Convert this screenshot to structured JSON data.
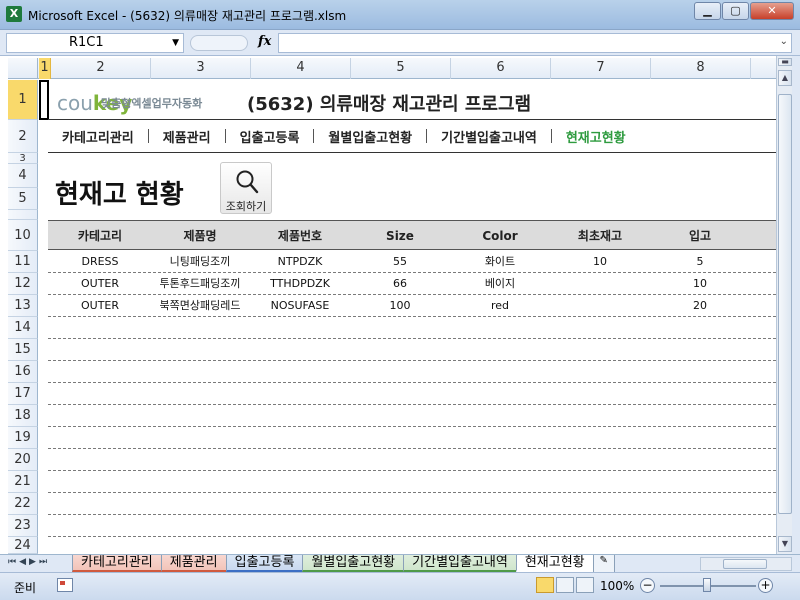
{
  "window": {
    "app_icon": "X",
    "title": "Microsoft Excel - (5632) 의류매장 재고관리 프로그램.xlsm",
    "minimize": "▁",
    "maximize": "▢",
    "close": "✕"
  },
  "formula_bar": {
    "name_box": "R1C1",
    "fx": "fx",
    "formula": ""
  },
  "columns": [
    "1",
    "2",
    "3",
    "4",
    "5",
    "6",
    "7",
    "8"
  ],
  "rows": [
    "1",
    "2",
    "3",
    "4",
    "5",
    "10",
    "11",
    "12",
    "13",
    "14",
    "15",
    "16",
    "17",
    "18",
    "19",
    "20",
    "21",
    "22",
    "23",
    "24"
  ],
  "sheet": {
    "brand": {
      "cou": "cou",
      "key": "key",
      "sub": "맞춤형엑셀업무자동화"
    },
    "app_title": "(5632) 의류매장 재고관리 프로그램",
    "menu": [
      "카테고리관리",
      "제품관리",
      "입출고등록",
      "월별입출고현황",
      "기간별입출고내역",
      "현재고현황"
    ],
    "active_menu": "현재고현황",
    "page_title": "현재고 현황",
    "search_button": "조회하기",
    "table": {
      "headers": [
        "카테고리",
        "제품명",
        "제품번호",
        "Size",
        "Color",
        "최초재고",
        "입고"
      ],
      "rows": [
        [
          "DRESS",
          "니팅패딩조끼",
          "NTPDZK",
          "55",
          "화이트",
          "10",
          "5"
        ],
        [
          "OUTER",
          "투톤후드패딩조끼",
          "TTHDPDZK",
          "66",
          "베이지",
          "",
          "10"
        ],
        [
          "OUTER",
          "북쪽면상패딩레드",
          "NOSUFASE",
          "100",
          "red",
          "",
          "20"
        ]
      ]
    }
  },
  "sheet_tabs": {
    "tabs": [
      "카테고리관리",
      "제품관리",
      "입출고등록",
      "월별입출고현황",
      "기간별입출고내역",
      "현재고현황"
    ],
    "active": "현재고현황"
  },
  "status_bar": {
    "ready": "준비",
    "zoom": "100%",
    "zoom_level": 100
  },
  "colors": {
    "active_menu": "#2e9b3f",
    "header_selected": "#f9d96b",
    "brand_key": "#7fb43a"
  }
}
